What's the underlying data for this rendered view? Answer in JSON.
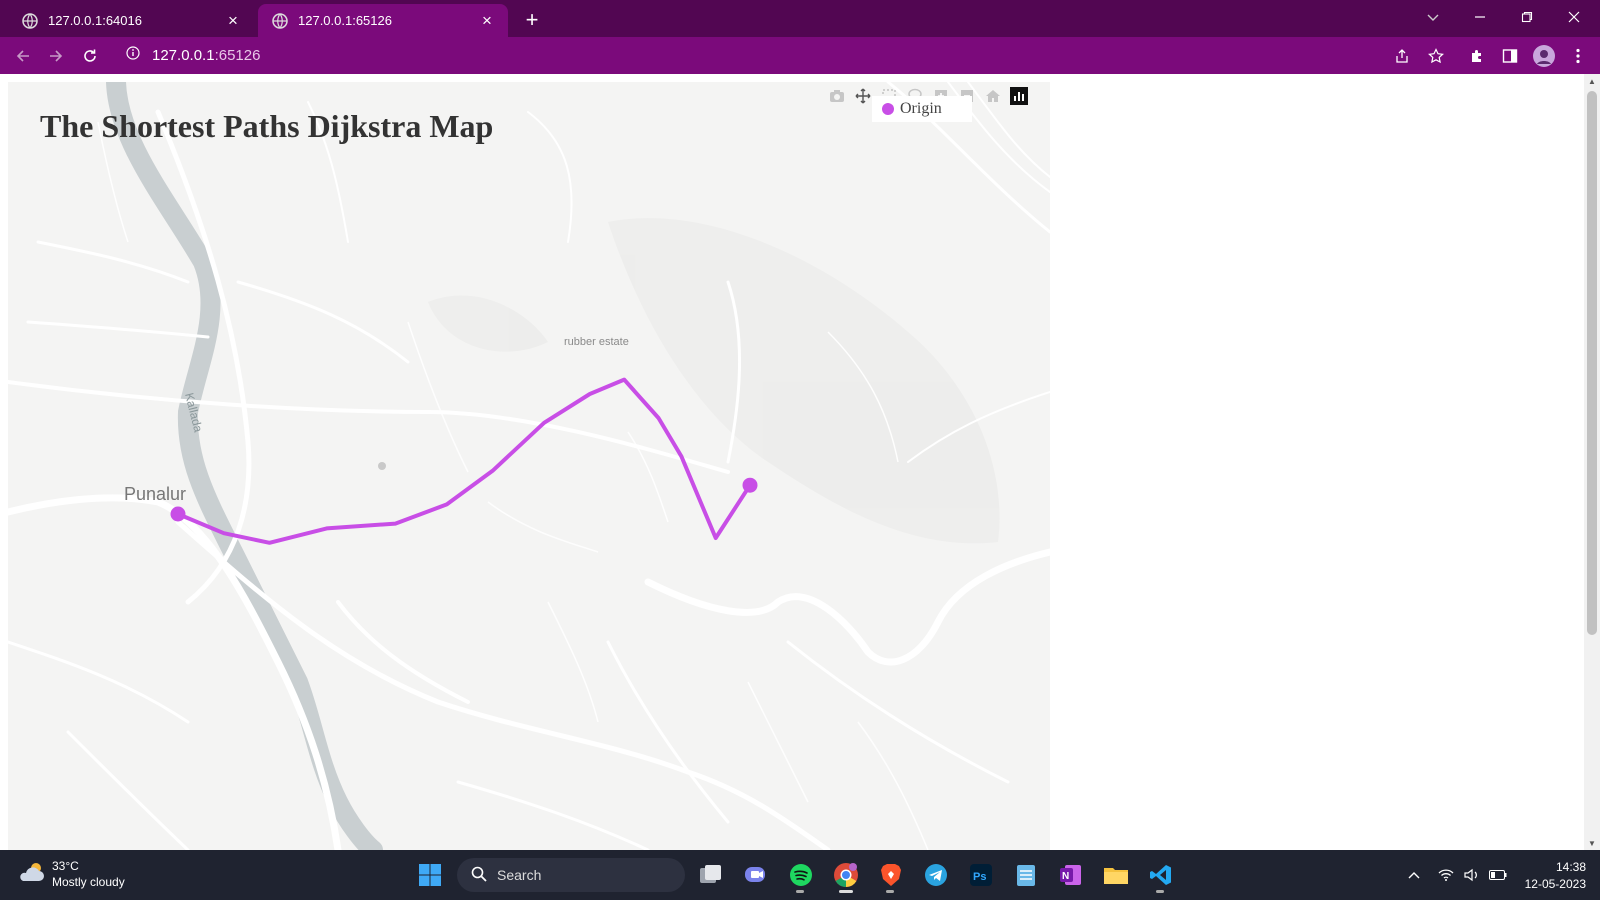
{
  "browser": {
    "tabs": [
      {
        "title": "127.0.0.1:64016",
        "active": false
      },
      {
        "title": "127.0.0.1:65126",
        "active": true
      }
    ],
    "url_host": "127.0.0.1",
    "url_port": ":65126"
  },
  "map": {
    "title": "The Shortest Paths Dijkstra Map",
    "place_label": "Punalur",
    "area_label": "rubber estate",
    "river_label": "Kallada",
    "legend": {
      "label": "Origin",
      "color": "#c84ee6"
    },
    "route_color": "#c84ee6",
    "route": [
      [
        0.0,
        0.0
      ],
      [
        0.08,
        0.04
      ],
      [
        0.16,
        0.06
      ],
      [
        0.26,
        0.03
      ],
      [
        0.38,
        0.02
      ],
      [
        0.47,
        -0.02
      ],
      [
        0.55,
        -0.09
      ],
      [
        0.64,
        -0.19
      ],
      [
        0.72,
        -0.25
      ],
      [
        0.78,
        -0.28
      ],
      [
        0.84,
        -0.2
      ],
      [
        0.88,
        -0.12
      ],
      [
        0.94,
        0.05
      ],
      [
        1.0,
        -0.06
      ]
    ]
  },
  "taskbar": {
    "weather_temp": "33°C",
    "weather_desc": "Mostly cloudy",
    "search_label": "Search",
    "time": "14:38",
    "date": "12-05-2023"
  }
}
